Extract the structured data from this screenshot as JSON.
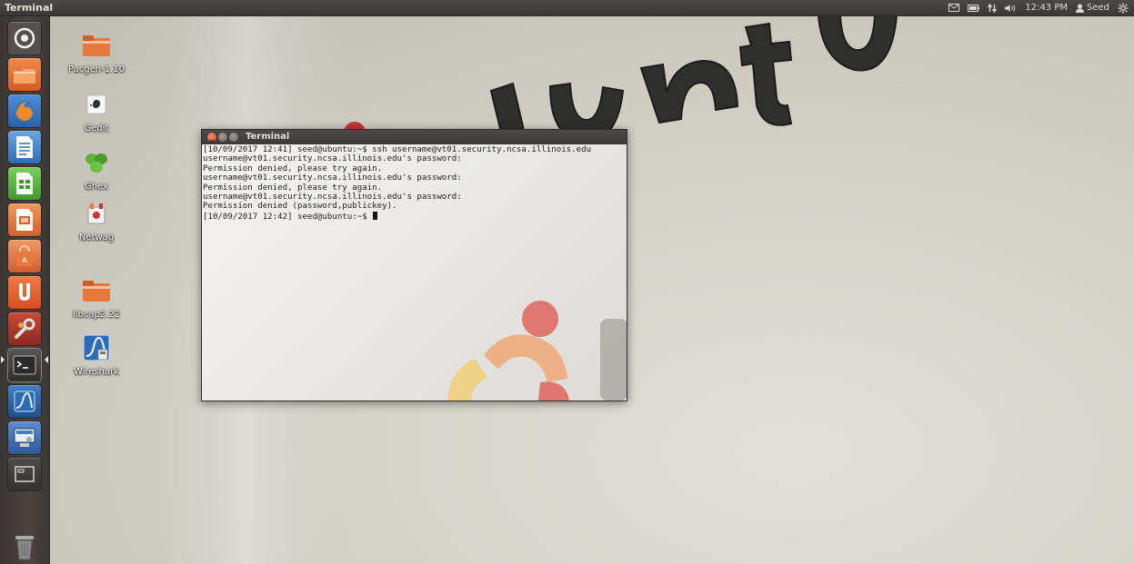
{
  "top_panel": {
    "active_app": "Terminal",
    "clock": "12:43 PM",
    "user_name": "Seed",
    "indicators": [
      "mail-icon",
      "battery-icon",
      "network-icon",
      "volume-icon",
      "user-icon",
      "gear-icon"
    ]
  },
  "launcher": {
    "items": [
      {
        "name": "dash-home-icon"
      },
      {
        "name": "files-icon"
      },
      {
        "name": "firefox-icon"
      },
      {
        "name": "libreoffice-writer-icon"
      },
      {
        "name": "libreoffice-calc-icon"
      },
      {
        "name": "libreoffice-impress-icon"
      },
      {
        "name": "software-center-icon"
      },
      {
        "name": "ubuntu-one-icon"
      },
      {
        "name": "system-settings-icon"
      },
      {
        "name": "terminal-icon",
        "active": true
      },
      {
        "name": "wireshark-icon"
      },
      {
        "name": "workspace-switcher-icon"
      },
      {
        "name": "desktop-window-icon"
      },
      {
        "name": "trash-icon"
      }
    ]
  },
  "desktop": {
    "wallpaper_text": "ubuntu",
    "icons": [
      {
        "label": "Pacgen-1.10",
        "icon": "folder-icon"
      },
      {
        "label": "Gedit",
        "icon": "gedit-icon"
      },
      {
        "label": "Ghex",
        "icon": "ghex-icon"
      },
      {
        "label": "Netwag",
        "icon": "netwag-icon"
      },
      {
        "label": "libcap2.22",
        "icon": "folder-icon"
      },
      {
        "label": "Wireshark",
        "icon": "wireshark-icon"
      }
    ]
  },
  "terminal": {
    "title": "Terminal",
    "lines": [
      "[10/09/2017 12:41] seed@ubuntu:~$ ssh username@vt01.security.ncsa.illinois.edu",
      "username@vt01.security.ncsa.illinois.edu's password:",
      "Permission denied, please try again.",
      "username@vt01.security.ncsa.illinois.edu's password:",
      "Permission denied, please try again.",
      "username@vt01.security.ncsa.illinois.edu's password:",
      "Permission denied (password,publickey).",
      "[10/09/2017 12:42] seed@ubuntu:~$ "
    ]
  },
  "colors": {
    "panel": "#3c3b37",
    "launcher": "#433d3a",
    "close_button": "#e0582f",
    "ubuntu_orange": "#e9703a"
  }
}
